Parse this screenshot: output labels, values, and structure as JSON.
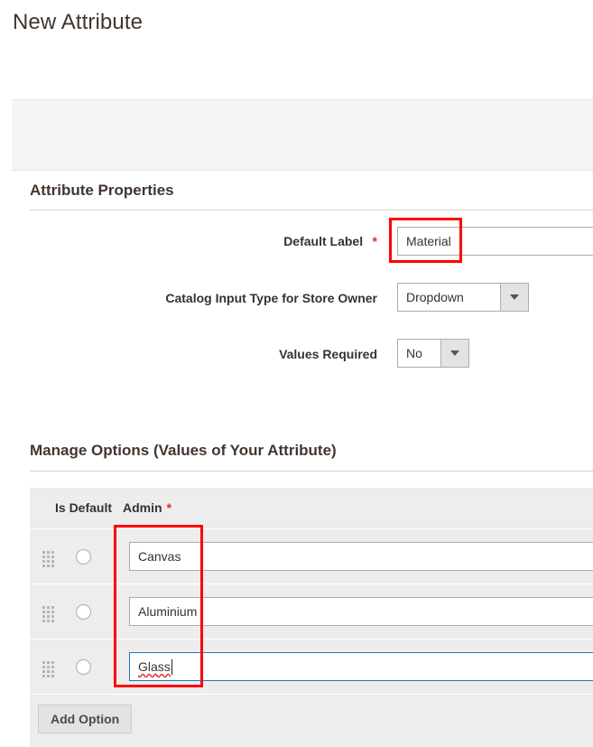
{
  "page": {
    "title": "New Attribute"
  },
  "sections": {
    "attribute_properties": {
      "title": "Attribute Properties",
      "fields": {
        "default_label": {
          "label": "Default Label",
          "required_marker": "*",
          "value": "Material"
        },
        "catalog_input_type": {
          "label": "Catalog Input Type for Store Owner",
          "value": "Dropdown"
        },
        "values_required": {
          "label": "Values Required",
          "value": "No"
        }
      }
    },
    "manage_options": {
      "title": "Manage Options (Values of Your Attribute)",
      "table": {
        "headers": {
          "is_default": "Is Default",
          "admin": "Admin",
          "admin_required_marker": "*"
        },
        "rows": [
          {
            "value": "Canvas",
            "focused": false,
            "misspelled": false
          },
          {
            "value": "Aluminium",
            "focused": false,
            "misspelled": false
          },
          {
            "value": "Glass",
            "focused": true,
            "misspelled": true
          }
        ]
      },
      "add_option_label": "Add Option"
    }
  },
  "colors": {
    "annotation": "#ff0000",
    "focus_border": "#1979c3",
    "required_star": "#e02b27",
    "heading": "#41362f",
    "table_bg": "#ededed"
  }
}
